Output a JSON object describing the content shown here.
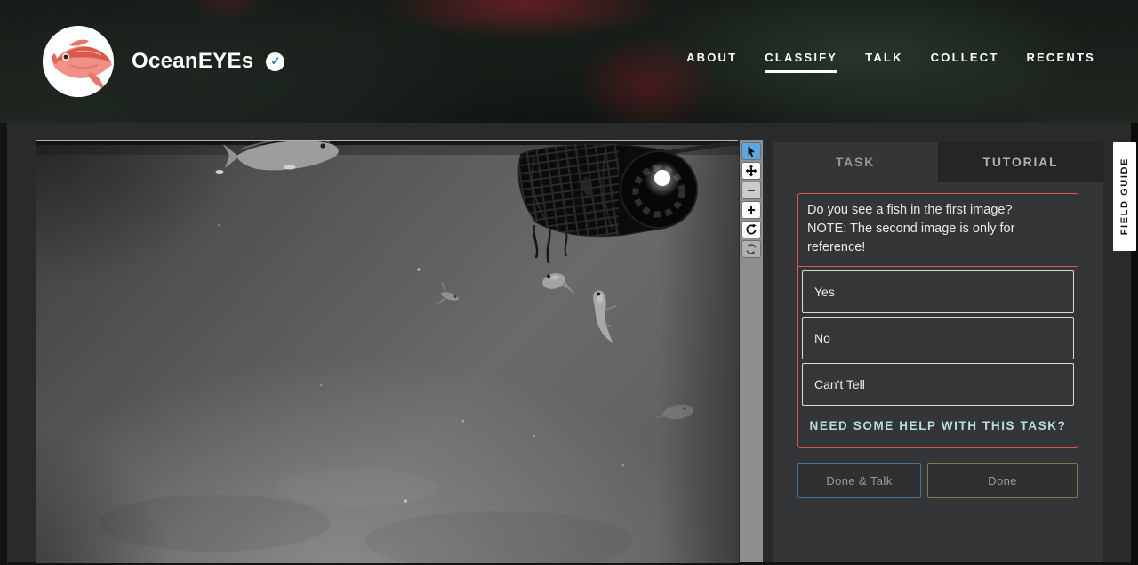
{
  "header": {
    "title": "OceanEYEs",
    "verified_check": "✓",
    "nav": {
      "items": [
        {
          "label": "ABOUT"
        },
        {
          "label": "CLASSIFY"
        },
        {
          "label": "TALK"
        },
        {
          "label": "COLLECT"
        },
        {
          "label": "RECENTS"
        }
      ],
      "active": "CLASSIFY"
    }
  },
  "viewer": {
    "description": "greyscale underwater camera frame with fish and a baited instrument",
    "toolbar_tools": [
      "select",
      "pan",
      "zoom-out",
      "zoom-in",
      "rotate",
      "reset"
    ]
  },
  "panel": {
    "tabs": [
      {
        "label": "TASK",
        "active": true
      },
      {
        "label": "TUTORIAL",
        "active": false
      }
    ],
    "task": {
      "question_line1": "Do you see a fish in the first image?",
      "question_line2": "NOTE: The second image is only for reference!",
      "answers": [
        "Yes",
        "No",
        "Can't Tell"
      ],
      "help_link": "NEED SOME HELP WITH THIS TASK?"
    },
    "actions": {
      "done_talk": "Done & Talk",
      "done": "Done"
    }
  },
  "field_guide": {
    "label": "FIELD GUIDE"
  },
  "colors": {
    "task_border_red": "#e0564f",
    "help_teal": "#b9dde1",
    "done_talk_border_blue": "#44749d",
    "done_border_olive": "#7b7b4f",
    "active_tool_blue": "#5ba7e2",
    "verified_badge_blue": "#2f7f9d"
  }
}
